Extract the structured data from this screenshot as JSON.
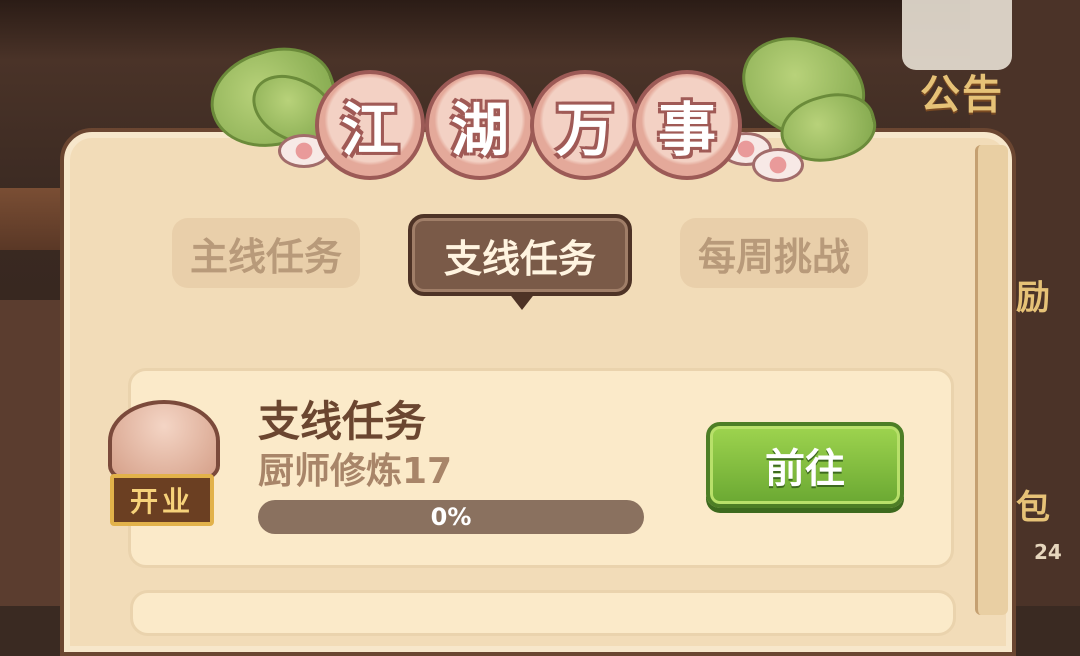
{
  "title": {
    "chars": [
      "江",
      "湖",
      "万",
      "事"
    ]
  },
  "tabs": [
    {
      "label": "主线任务",
      "active": false
    },
    {
      "label": "支线任务",
      "active": true
    },
    {
      "label": "每周挑战",
      "active": false
    }
  ],
  "task": {
    "icon_label": "开业",
    "title": "支线任务",
    "subtitle": "厨师修炼17",
    "progress": 0,
    "progress_text": "0%",
    "button_label": "前往"
  },
  "background": {
    "notice_label": "公告",
    "side_glyph_1": "励",
    "side_glyph_2": "包",
    "side_number": "24"
  },
  "colors": {
    "accent_green": "#7ab83c",
    "panel": "#f2dcb8",
    "active_tab": "#7a5a48"
  }
}
